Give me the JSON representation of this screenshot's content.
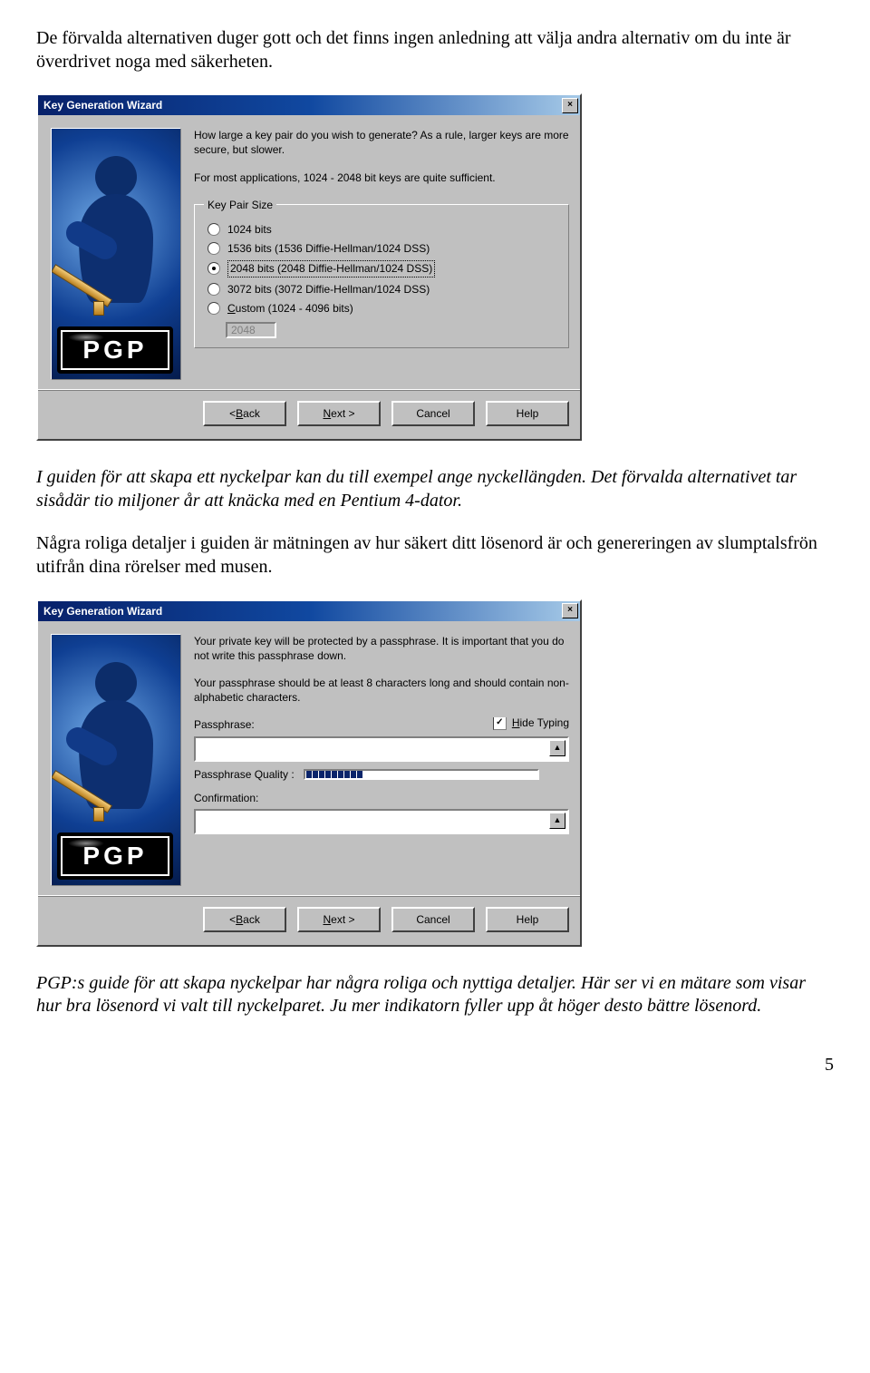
{
  "para1": "De förvalda alternativen duger gott och det finns ingen anledning att välja andra alternativ om du inte är överdrivet noga med säkerheten.",
  "para2": "I guiden för att skapa ett nyckelpar kan du till exempel ange nyckellängden. Det förvalda alternativet tar sisådär tio miljoner år att knäcka med en Pentium 4-dator.",
  "para3": "Några roliga detaljer i guiden är mätningen av hur säkert ditt lösenord är och genereringen av slumptalsfrön utifrån dina rörelser med musen.",
  "para4": "PGP:s guide för att skapa nyckelpar har några roliga och nyttiga detaljer. Här ser vi en mätare som visar hur bra lösenord vi valt till nyckelparet. Ju mer indikatorn fyller upp åt höger desto bättre lösenord.",
  "page_number": "5",
  "dialog1": {
    "title": "Key Generation Wizard",
    "close": "×",
    "body_line1": "How large a key pair do you wish to generate?  As a rule, larger keys are more secure, but slower.",
    "body_line2": "For most applications, 1024 - 2048 bit keys are quite sufficient.",
    "group_legend": "Key Pair Size",
    "radios": [
      {
        "selected": false,
        "label": "1024 bits"
      },
      {
        "selected": false,
        "label": "1536 bits (1536 Diffie-Hellman/1024 DSS)"
      },
      {
        "selected": true,
        "label": "2048 bits (2048 Diffie-Hellman/1024 DSS)"
      },
      {
        "selected": false,
        "label": "3072 bits (3072 Diffie-Hellman/1024 DSS)"
      }
    ],
    "custom_prefix": "C",
    "custom_label_rest": "ustom (1024 - 4096 bits)",
    "custom_value": "2048",
    "pgp": "PGP"
  },
  "dialog2": {
    "title": "Key Generation Wizard",
    "close": "×",
    "body_line1": "Your private key will be protected by a passphrase.  It is important that you do not write this passphrase down.",
    "body_line2": "Your passphrase should be at least 8 characters long and should contain non-alphabetic characters.",
    "passphrase_label": "Passphrase:",
    "hide_prefix": "H",
    "hide_rest": "ide Typing",
    "hide_checked": "✓",
    "quality_label": "Passphrase Quality :",
    "confirm_label": "Confirmation:",
    "pgp": "PGP"
  },
  "buttons": {
    "back_prefix": "< ",
    "back_u": "B",
    "back_rest": "ack",
    "next_u": "N",
    "next_rest": "ext >",
    "cancel": "Cancel",
    "help": "Help"
  }
}
